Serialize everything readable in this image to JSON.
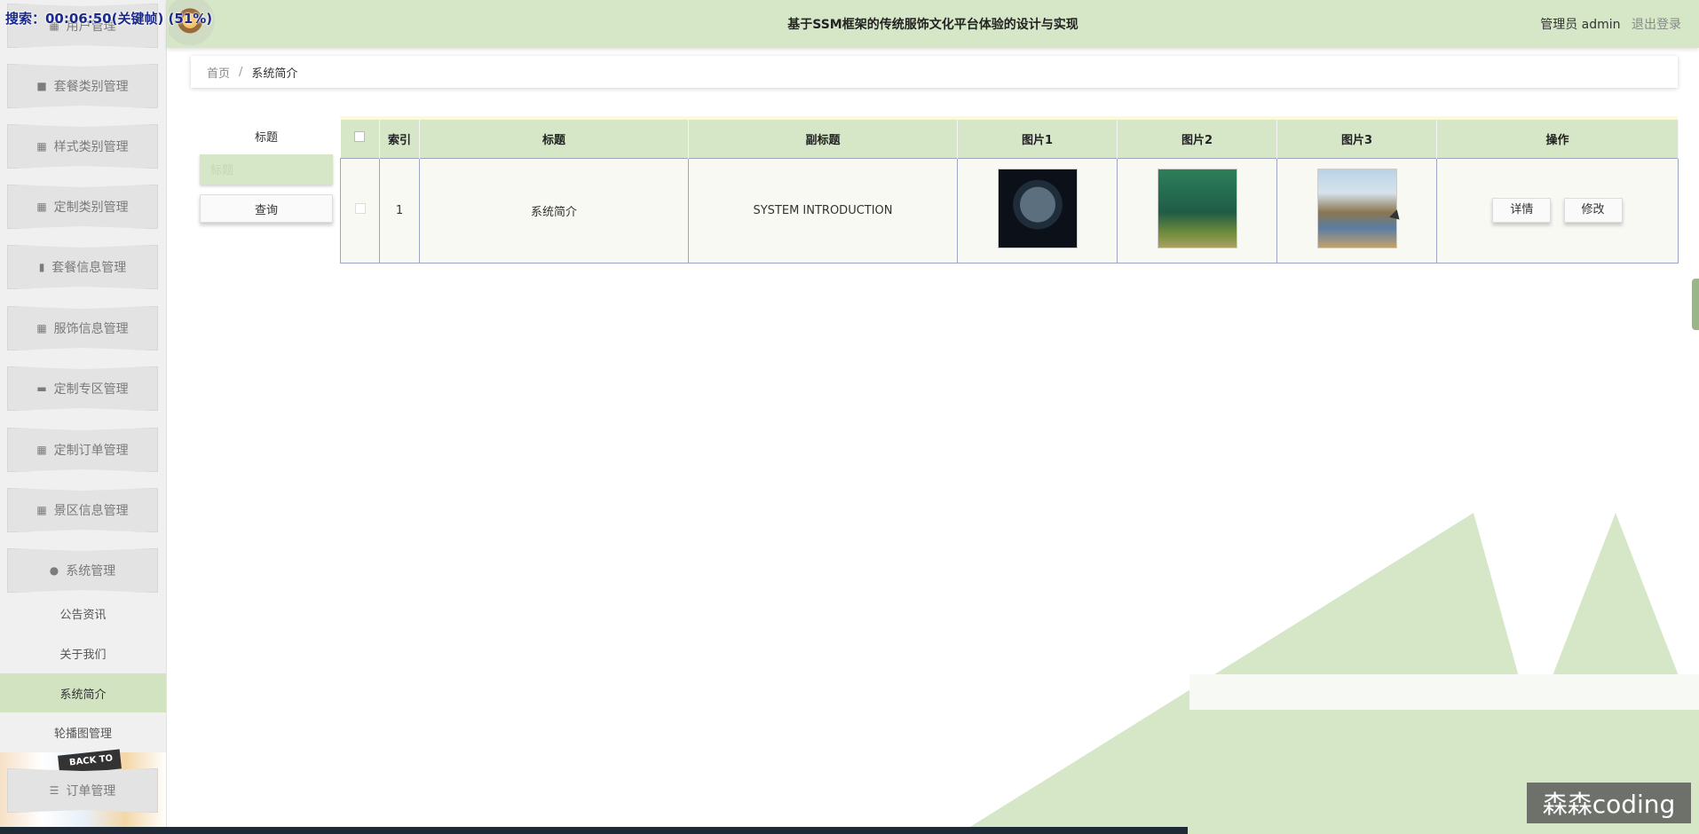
{
  "overlay": {
    "timer": "搜索：00:06:50(关键帧) (51%)"
  },
  "header": {
    "title": "基于SSM框架的传统服饰文化平台体验的设计与实现",
    "user": "管理员 admin",
    "logout": "退出登录"
  },
  "sidebar": {
    "items": [
      {
        "label": "用户管理",
        "icon": "grid-icon"
      },
      {
        "label": "套餐类别管理",
        "icon": "briefcase-icon"
      },
      {
        "label": "样式类别管理",
        "icon": "grid-icon"
      },
      {
        "label": "定制类别管理",
        "icon": "grid-icon"
      },
      {
        "label": "套餐信息管理",
        "icon": "clipboard-icon"
      },
      {
        "label": "服饰信息管理",
        "icon": "grid-icon"
      },
      {
        "label": "定制专区管理",
        "icon": "monitor-icon"
      },
      {
        "label": "定制订单管理",
        "icon": "grid-icon"
      },
      {
        "label": "景区信息管理",
        "icon": "grid-icon"
      },
      {
        "label": "系统管理",
        "icon": "pin-icon"
      }
    ],
    "sub_items": [
      "公告资讯",
      "关于我们",
      "系统简介",
      "轮播图管理"
    ],
    "active_sub": "系统简介",
    "bottom_item": {
      "label": "订单管理",
      "icon": "list-icon"
    },
    "deco_text": "BACK TO"
  },
  "breadcrumb": {
    "home": "首页",
    "separator": "/",
    "current": "系统简介"
  },
  "search": {
    "label": "标题",
    "placeholder": "标题",
    "button": "查询"
  },
  "table": {
    "headers": [
      "索引",
      "标题",
      "副标题",
      "图片1",
      "图片2",
      "图片3",
      "操作"
    ],
    "rows": [
      {
        "index": "1",
        "title": "系统简介",
        "subtitle": "SYSTEM INTRODUCTION",
        "detail": "详情",
        "edit": "修改"
      }
    ]
  },
  "watermark": "森森coding",
  "colors": {
    "accent": "#d5e7c7",
    "sidebar_bg": "#f0f0f0"
  }
}
